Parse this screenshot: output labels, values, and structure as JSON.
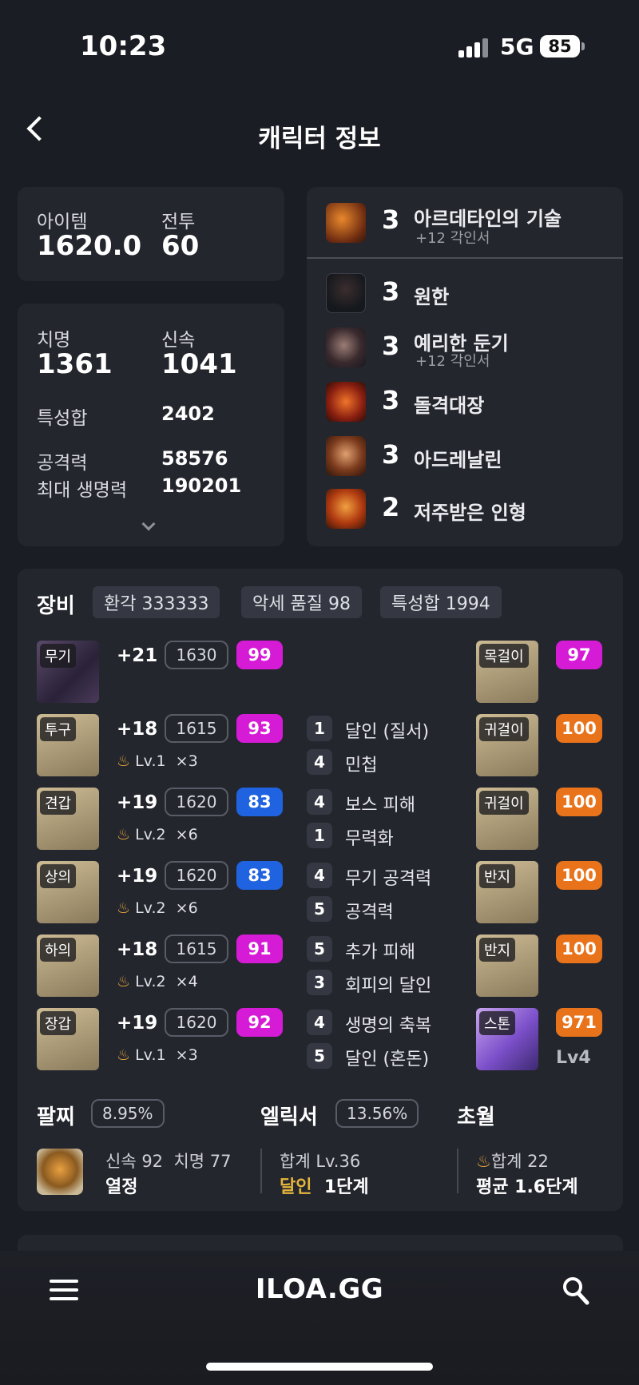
{
  "status_bar": {
    "time": "10:23",
    "network": "5G",
    "battery": "85"
  },
  "header": {
    "title": "캐릭터 정보"
  },
  "summary": {
    "item_label": "아이템",
    "item_value": "1620.0",
    "combat_label": "전투",
    "combat_value": "60"
  },
  "stats": {
    "crit_label": "치명",
    "crit_value": "1361",
    "swift_label": "신속",
    "swift_value": "1041",
    "total_label": "특성합",
    "total_value": "2402",
    "attack_label": "공격력",
    "attack_value": "58576",
    "hp_label": "최대 생명력",
    "hp_value": "190201"
  },
  "engravings": [
    {
      "level": "3",
      "name": "아르데타인의 기술",
      "sub": "+12 각인서",
      "icon": "mech-gun-icon"
    },
    {
      "level": "3",
      "name": "원한",
      "sub": "",
      "icon": "demon-icon"
    },
    {
      "level": "3",
      "name": "예리한 둔기",
      "sub": "+12 각인서",
      "icon": "spiked-ball-icon"
    },
    {
      "level": "3",
      "name": "돌격대장",
      "sub": "",
      "icon": "charge-icon"
    },
    {
      "level": "3",
      "name": "아드레날린",
      "sub": "",
      "icon": "adrenaline-icon"
    },
    {
      "level": "2",
      "name": "저주받은 인형",
      "sub": "",
      "icon": "cursed-doll-icon"
    }
  ],
  "equipment": {
    "title": "장비",
    "chips": [
      "환각 333333",
      "악세 품질 98",
      "특성합 1994"
    ],
    "gear": [
      {
        "tag": "무기",
        "plus": "+21",
        "ilvl": "1630",
        "quality": "99",
        "quality_color": "#d61bd6",
        "elix_lv": "",
        "elix_count": ""
      },
      {
        "tag": "투구",
        "plus": "+18",
        "ilvl": "1615",
        "quality": "93",
        "quality_color": "#d61bd6",
        "elix_lv": "Lv.1",
        "elix_count": "×3"
      },
      {
        "tag": "견갑",
        "plus": "+19",
        "ilvl": "1620",
        "quality": "83",
        "quality_color": "#1f63e0",
        "elix_lv": "Lv.2",
        "elix_count": "×6"
      },
      {
        "tag": "상의",
        "plus": "+19",
        "ilvl": "1620",
        "quality": "83",
        "quality_color": "#1f63e0",
        "elix_lv": "Lv.2",
        "elix_count": "×6"
      },
      {
        "tag": "하의",
        "plus": "+18",
        "ilvl": "1615",
        "quality": "91",
        "quality_color": "#d61bd6",
        "elix_lv": "Lv.2",
        "elix_count": "×4"
      },
      {
        "tag": "장갑",
        "plus": "+19",
        "ilvl": "1620",
        "quality": "92",
        "quality_color": "#d61bd6",
        "elix_lv": "Lv.1",
        "elix_count": "×3"
      }
    ],
    "options": [
      {
        "num": "1",
        "name": "달인 (질서)"
      },
      {
        "num": "4",
        "name": "민첩"
      },
      {
        "num": "4",
        "name": "보스 피해"
      },
      {
        "num": "1",
        "name": "무력화"
      },
      {
        "num": "4",
        "name": "무기 공격력"
      },
      {
        "num": "5",
        "name": "공격력"
      },
      {
        "num": "5",
        "name": "추가 피해"
      },
      {
        "num": "3",
        "name": "회피의 달인"
      },
      {
        "num": "4",
        "name": "생명의 축복"
      },
      {
        "num": "5",
        "name": "달인 (혼돈)"
      }
    ],
    "accessories": [
      {
        "tag": "목걸이",
        "quality": "97",
        "quality_color": "#d61bd6"
      },
      {
        "tag": "귀걸이",
        "quality": "100",
        "quality_color": "#e8731a"
      },
      {
        "tag": "귀걸이",
        "quality": "100",
        "quality_color": "#e8731a"
      },
      {
        "tag": "반지",
        "quality": "100",
        "quality_color": "#e8731a"
      },
      {
        "tag": "반지",
        "quality": "100",
        "quality_color": "#e8731a"
      },
      {
        "tag": "스톤",
        "quality": "971",
        "quality_color": "#e8731a",
        "extra": "Lv4"
      }
    ]
  },
  "bracelet": {
    "title": "팔찌",
    "pct": "8.95%",
    "stat1": "신속 92",
    "stat2": "치명 77",
    "effect": "열정"
  },
  "elixir": {
    "title": "엘릭서",
    "pct": "13.56%",
    "total": "합계 Lv.36",
    "name": "달인",
    "stage": "1단계"
  },
  "transcend": {
    "title": "초월",
    "total": "합계 22",
    "avg": "평균 1.6단계"
  },
  "bottom_bar": {
    "logo": "ILOA.GG"
  }
}
